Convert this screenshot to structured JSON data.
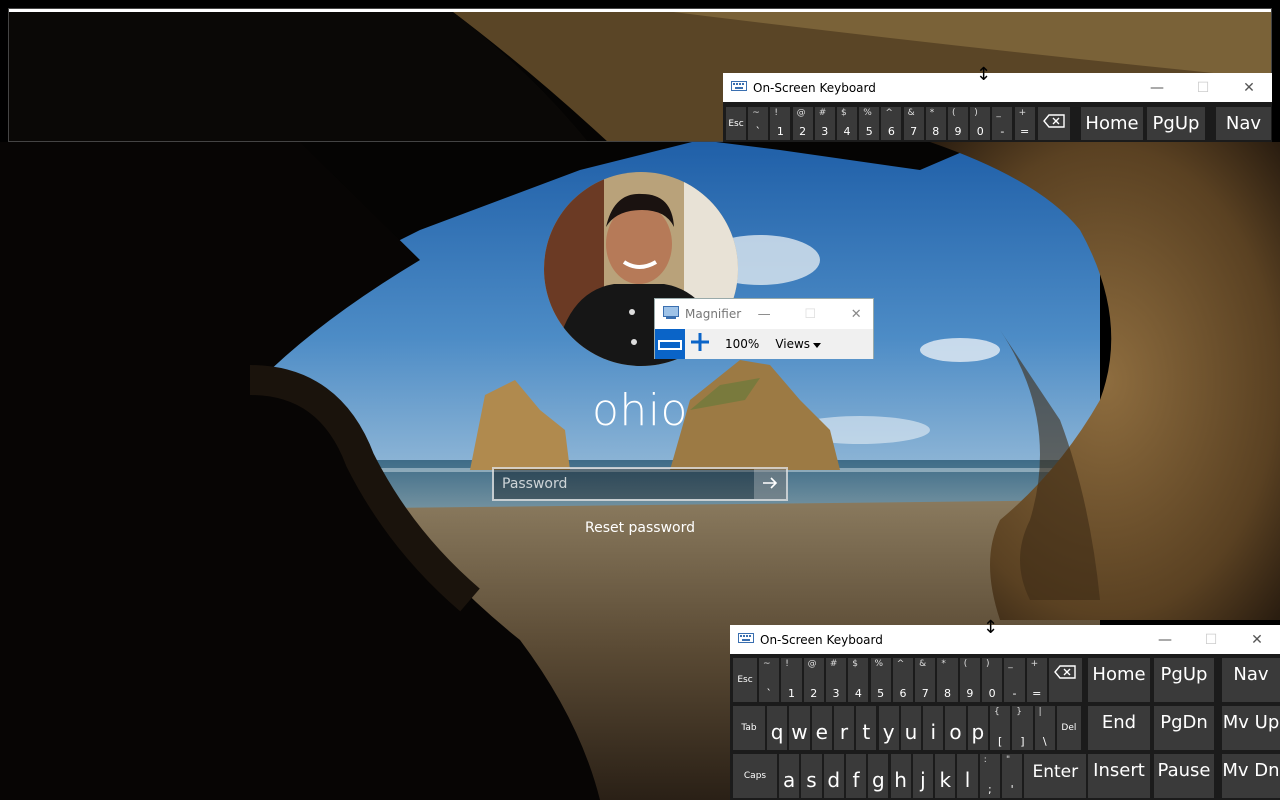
{
  "login": {
    "user_name": "ohio",
    "password_placeholder": "Password",
    "reset_password": "Reset password"
  },
  "magnifier": {
    "title": "Magnifier",
    "zoom_level": "100%",
    "views_label": "Views",
    "minimize": "—",
    "maximize": "☐",
    "close": "✕"
  },
  "osk_top": {
    "title": "On-Screen Keyboard",
    "minimize": "—",
    "maximize": "☐",
    "close": "✕"
  },
  "osk_bottom": {
    "title": "On-Screen Keyboard",
    "minimize": "—",
    "maximize": "☐",
    "close": "✕"
  },
  "keyboard": {
    "number_row": [
      {
        "main": "Esc",
        "shift": ""
      },
      {
        "main": "`",
        "shift": "~"
      },
      {
        "main": "1",
        "shift": "!"
      },
      {
        "main": "2",
        "shift": "@"
      },
      {
        "main": "3",
        "shift": "#"
      },
      {
        "main": "4",
        "shift": "$"
      },
      {
        "main": "5",
        "shift": "%"
      },
      {
        "main": "6",
        "shift": "^"
      },
      {
        "main": "7",
        "shift": "&"
      },
      {
        "main": "8",
        "shift": "*"
      },
      {
        "main": "9",
        "shift": "("
      },
      {
        "main": "0",
        "shift": ")"
      },
      {
        "main": "-",
        "shift": "_"
      },
      {
        "main": "=",
        "shift": "+"
      }
    ],
    "qwerty_row": [
      {
        "main": "Tab",
        "shift": ""
      },
      {
        "main": "q",
        "shift": ""
      },
      {
        "main": "w",
        "shift": ""
      },
      {
        "main": "e",
        "shift": ""
      },
      {
        "main": "r",
        "shift": ""
      },
      {
        "main": "t",
        "shift": ""
      },
      {
        "main": "y",
        "shift": ""
      },
      {
        "main": "u",
        "shift": ""
      },
      {
        "main": "i",
        "shift": ""
      },
      {
        "main": "o",
        "shift": ""
      },
      {
        "main": "p",
        "shift": ""
      },
      {
        "main": "[",
        "shift": "{"
      },
      {
        "main": "]",
        "shift": "}"
      },
      {
        "main": "\\",
        "shift": "|"
      },
      {
        "main": "Del",
        "shift": ""
      }
    ],
    "home_row": [
      {
        "main": "Caps",
        "shift": ""
      },
      {
        "main": "a",
        "shift": ""
      },
      {
        "main": "s",
        "shift": ""
      },
      {
        "main": "d",
        "shift": ""
      },
      {
        "main": "f",
        "shift": ""
      },
      {
        "main": "g",
        "shift": ""
      },
      {
        "main": "h",
        "shift": ""
      },
      {
        "main": "j",
        "shift": ""
      },
      {
        "main": "k",
        "shift": ""
      },
      {
        "main": "l",
        "shift": ""
      },
      {
        "main": ";",
        "shift": ":"
      },
      {
        "main": "'",
        "shift": "\""
      },
      {
        "main": "Enter",
        "shift": ""
      }
    ],
    "nav_keys": {
      "home": "Home",
      "pgup": "PgUp",
      "nav": "Nav",
      "end": "End",
      "pgdn": "PgDn",
      "mvup": "Mv Up",
      "insert": "Insert",
      "pause": "Pause",
      "mvdn": "Mv Dn"
    }
  },
  "colors": {
    "key_bg": "#3a3a3a",
    "keyboard_bg": "#1b1b1b",
    "magnifier_accent": "#0a64c8"
  }
}
